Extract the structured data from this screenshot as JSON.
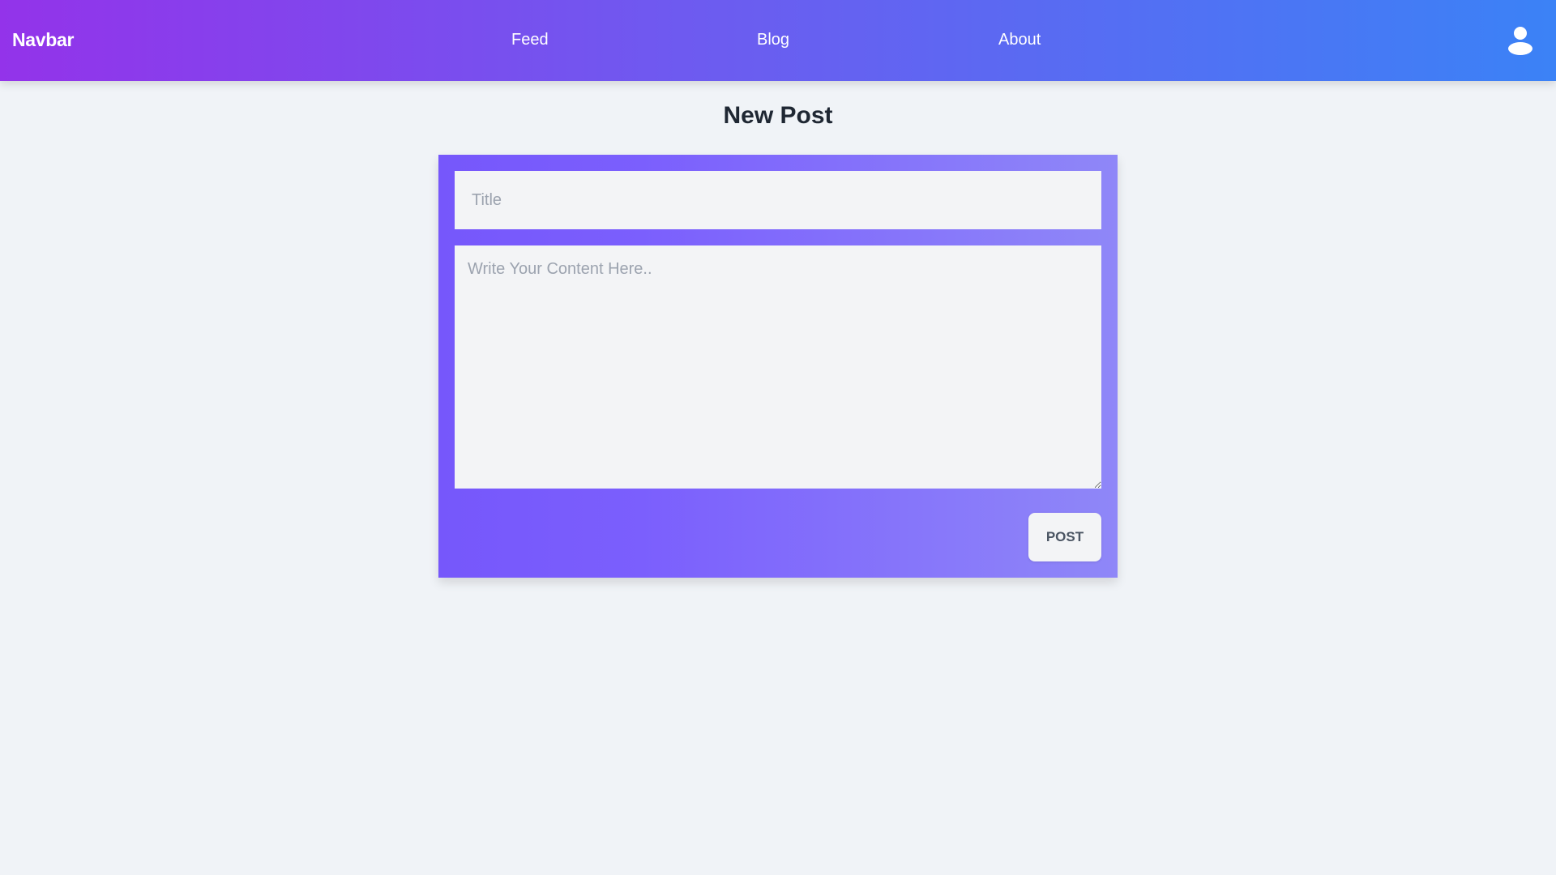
{
  "navbar": {
    "brand": "Navbar",
    "links": [
      {
        "label": "Feed"
      },
      {
        "label": "Blog"
      },
      {
        "label": "About"
      }
    ],
    "user_icon": "user-icon"
  },
  "main": {
    "title": "New Post",
    "form": {
      "title_input": {
        "value": "",
        "placeholder": "Title"
      },
      "content_input": {
        "value": "",
        "placeholder": "Write Your Content Here.."
      },
      "submit_label": "POST"
    }
  },
  "colors": {
    "navbar_gradient_start": "#9333ea",
    "navbar_gradient_end": "#3b82f6",
    "card_gradient_start": "#7657fb",
    "card_gradient_end": "#8f87f8",
    "page_background": "#f0f3f7",
    "heading_text": "#1f2733"
  }
}
